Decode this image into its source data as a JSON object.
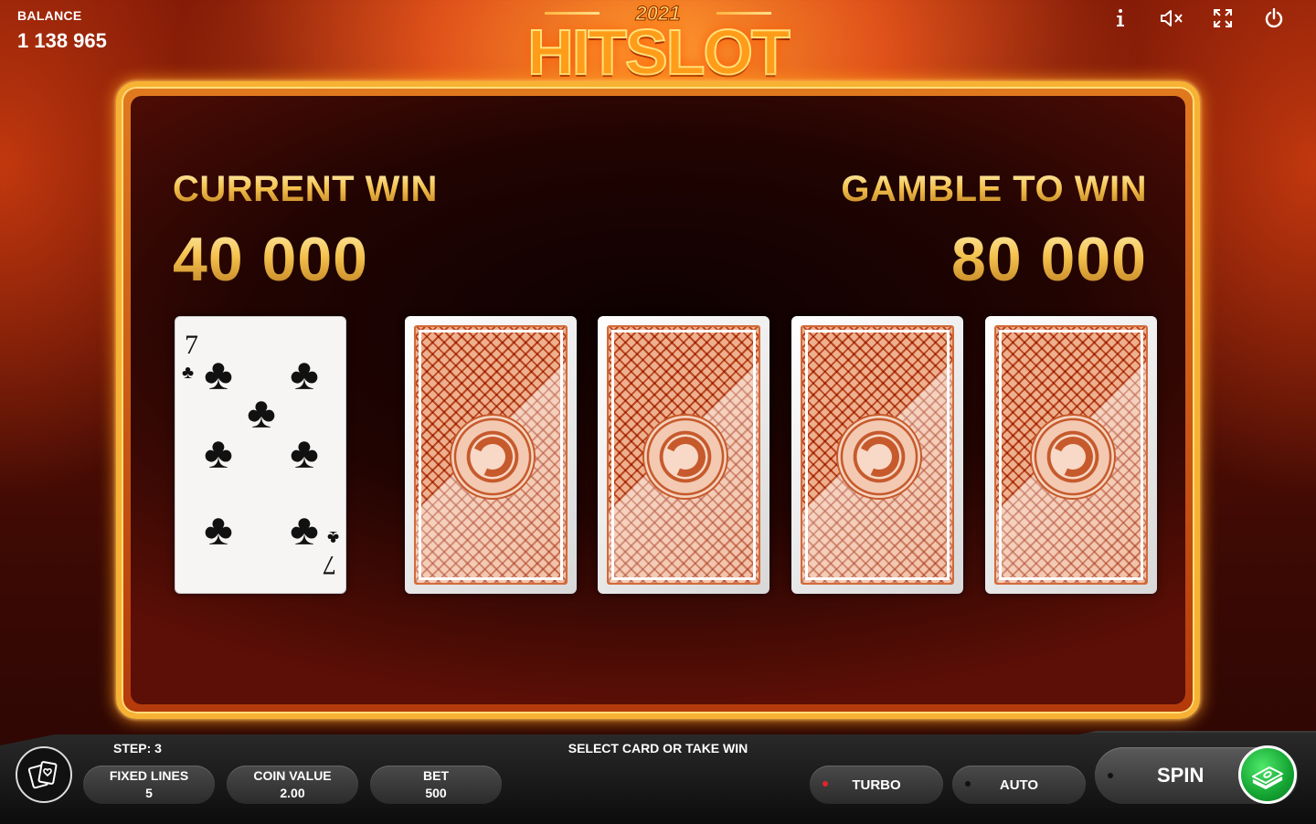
{
  "balance": {
    "label": "BALANCE",
    "value": "1 138 965"
  },
  "logo": {
    "year": "2021",
    "name": "HITSLOT"
  },
  "top_icons": [
    "info-icon",
    "sound-muted-icon",
    "fullscreen-icon",
    "power-icon"
  ],
  "gamble": {
    "current_win_label": "CURRENT WIN",
    "current_win_value": "40 000",
    "gamble_to_win_label": "GAMBLE TO WIN",
    "gamble_to_win_value": "80 000",
    "open_card": {
      "rank": "7",
      "suit": "♣"
    },
    "face_down_cards": 4
  },
  "status": {
    "step": "STEP: 3",
    "hint": "SELECT CARD OR TAKE WIN"
  },
  "controls": {
    "fixed_lines_label": "FIXED LINES",
    "fixed_lines_value": "5",
    "coin_value_label": "COIN VALUE",
    "coin_value_value": "2.00",
    "bet_label": "BET",
    "bet_value": "500",
    "turbo_label": "TURBO",
    "turbo_indicator_color": "#e0242c",
    "auto_label": "AUTO",
    "spin_label": "SPIN"
  },
  "colors": {
    "frame_gold": "#f7b233",
    "collect_green": "#14a432"
  }
}
